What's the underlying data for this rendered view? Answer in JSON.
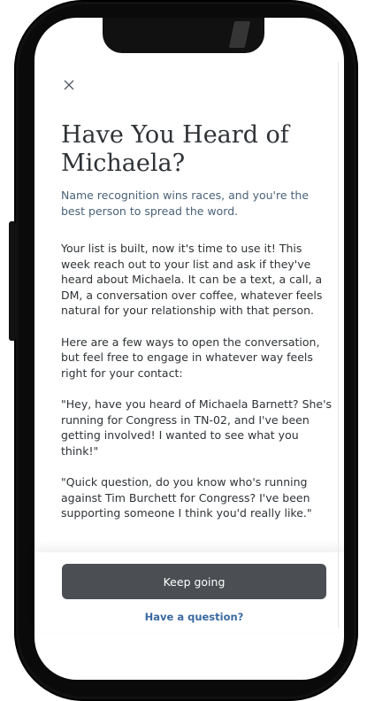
{
  "modal": {
    "title": "Have You Heard of Michaela?",
    "subtitle": "Name recognition wins races, and you're the best person to spread the word.",
    "paragraphs": [
      "Your list is built, now it's time to use it! This week reach out to your list and ask if they've heard about Michaela. It can be a text, a call, a DM, a conversation over coffee, whatever feels natural for your relationship with that person.",
      "Here are a few ways to open the conversation, but feel free to engage in whatever way feels right for your contact:",
      "\"Hey, have you heard of Michaela Barnett? She's running for Congress in TN-02, and I've been getting involved! I wanted to see what you think!\"",
      "\"Quick question, do you know who's running against Tim Burchett for Congress? I've been supporting someone I think you'd really like.\""
    ]
  },
  "actions": {
    "primary_label": "Keep going",
    "secondary_label": "Have a question?"
  },
  "icons": {
    "close": "close-icon"
  },
  "colors": {
    "primary_button": "#4b4f53",
    "link": "#3a6aa0",
    "subtitle": "#4b6278",
    "text": "#2f3336"
  }
}
